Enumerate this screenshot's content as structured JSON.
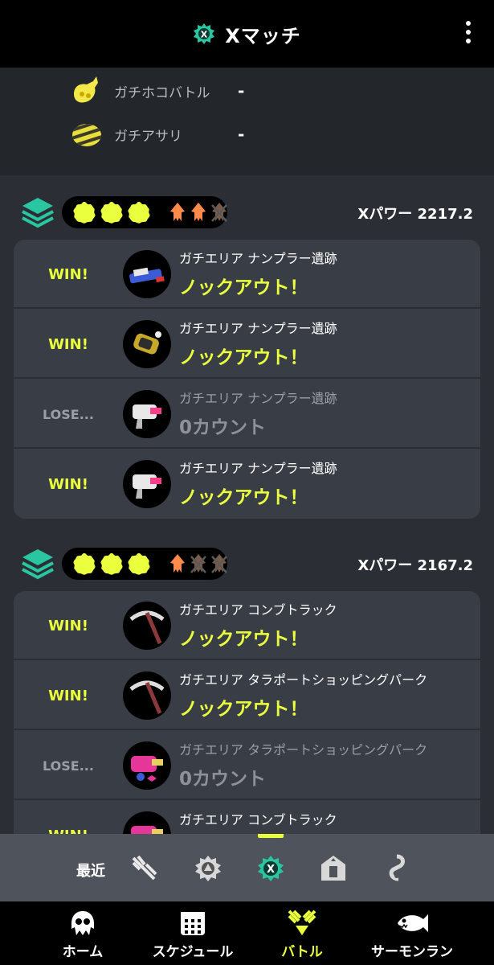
{
  "header": {
    "title": "Xマッチ",
    "icon": "x-match-emblem-icon"
  },
  "top_modes": [
    {
      "name": "ガチホコバトル",
      "value": "-",
      "icon": "rainmaker-icon"
    },
    {
      "name": "ガチアサリ",
      "value": "-",
      "icon": "clam-icon"
    }
  ],
  "sections": [
    {
      "xpower": "Xパワー 2217.2",
      "splats": 3,
      "squids": [
        "alive",
        "alive",
        "crossed"
      ],
      "matches": [
        {
          "result": "WIN!",
          "stage": "ガチエリア ナンプラー遺跡",
          "count": "ノックアウト！",
          "weapon": "blaster-weapon-icon"
        },
        {
          "result": "WIN!",
          "stage": "ガチエリア ナンプラー遺跡",
          "count": "ノックアウト！",
          "weapon": "gold-roller-weapon-icon"
        },
        {
          "result": "LOSE...",
          "stage": "ガチエリア ナンプラー遺跡",
          "count": "0カウント",
          "weapon": "white-shooter-weapon-icon"
        },
        {
          "result": "WIN!",
          "stage": "ガチエリア ナンプラー遺跡",
          "count": "ノックアウト！",
          "weapon": "white-shooter-weapon-icon"
        }
      ]
    },
    {
      "xpower": "Xパワー 2167.2",
      "splats": 3,
      "squids": [
        "alive",
        "crossed",
        "crossed"
      ],
      "matches": [
        {
          "result": "WIN!",
          "stage": "ガチエリア コンブトラック",
          "count": "ノックアウト！",
          "weapon": "pickaxe-weapon-icon"
        },
        {
          "result": "WIN!",
          "stage": "ガチエリア タラポートショッピングパーク",
          "count": "ノックアウト！",
          "weapon": "pickaxe-weapon-icon"
        },
        {
          "result": "LOSE...",
          "stage": "ガチエリア タラポートショッピングパーク",
          "count": "0カウント",
          "weapon": "pink-blaster-weapon-icon"
        },
        {
          "result": "WIN!",
          "stage": "ガチエリア コンブトラック",
          "count": "",
          "weapon": "pink-blaster-weapon-icon"
        }
      ]
    }
  ],
  "recent_bar": {
    "label": "最近",
    "icons": [
      "regular-battle-icon",
      "anarchy-battle-icon",
      "x-match-icon",
      "challenge-icon",
      "private-battle-icon"
    ],
    "selected": 2
  },
  "nav": {
    "items": [
      {
        "label": "ホーム",
        "icon": "squid-home-icon"
      },
      {
        "label": "スケジュール",
        "icon": "calendar-icon"
      },
      {
        "label": "バトル",
        "icon": "battle-icon",
        "active": true
      },
      {
        "label": "サーモンラン",
        "icon": "salmon-icon"
      }
    ]
  },
  "colors": {
    "accent": "#eaff3d",
    "squid": "#ff8a4c",
    "x_green": "#2ac6a2"
  }
}
